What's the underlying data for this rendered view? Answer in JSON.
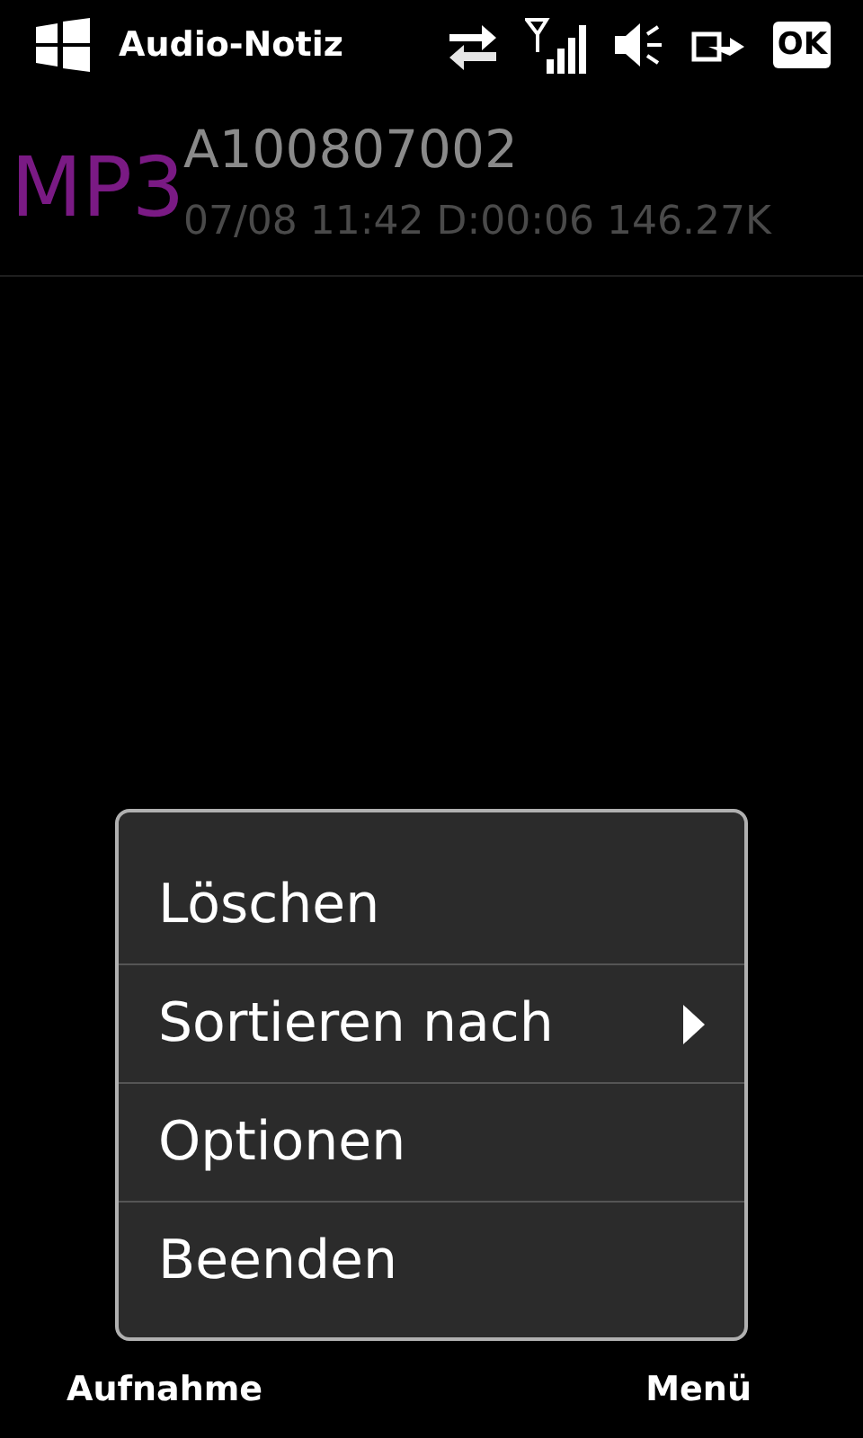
{
  "title_bar": {
    "title": "Audio-Notiz",
    "ok_button": "OK"
  },
  "list": [
    {
      "format": "MP3",
      "name": "A100807002",
      "details": "07/08 11:42 D:00:06 146.27K"
    }
  ],
  "menu": [
    {
      "label": "Löschen",
      "has_submenu": false
    },
    {
      "label": "Sortieren nach",
      "has_submenu": true
    },
    {
      "label": "Optionen",
      "has_submenu": false
    },
    {
      "label": "Beenden",
      "has_submenu": false
    }
  ],
  "softkeys": {
    "left": "Aufnahme",
    "right": "Menü"
  }
}
